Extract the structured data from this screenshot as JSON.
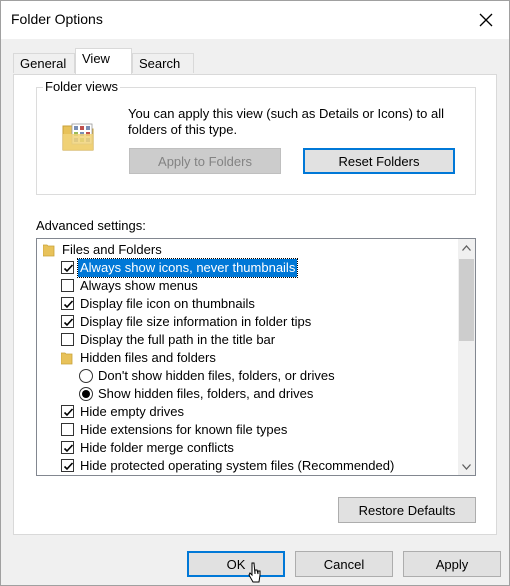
{
  "window": {
    "title": "Folder Options"
  },
  "tabs": [
    {
      "label": "General",
      "active": false
    },
    {
      "label": "View",
      "active": true
    },
    {
      "label": "Search",
      "active": false
    }
  ],
  "folder_views": {
    "legend": "Folder views",
    "description": "You can apply this view (such as Details or Icons) to all folders of this type.",
    "apply_button": "Apply to Folders",
    "reset_button": "Reset Folders"
  },
  "advanced": {
    "label": "Advanced settings:",
    "items": [
      {
        "type": "folder",
        "label": "Files and Folders",
        "level": 0
      },
      {
        "type": "checkbox",
        "label": "Always show icons, never thumbnails",
        "checked": true,
        "selected": true,
        "level": 1
      },
      {
        "type": "checkbox",
        "label": "Always show menus",
        "checked": false,
        "level": 1
      },
      {
        "type": "checkbox",
        "label": "Display file icon on thumbnails",
        "checked": true,
        "level": 1
      },
      {
        "type": "checkbox",
        "label": "Display file size information in folder tips",
        "checked": true,
        "level": 1
      },
      {
        "type": "checkbox",
        "label": "Display the full path in the title bar",
        "checked": false,
        "level": 1
      },
      {
        "type": "folder",
        "label": "Hidden files and folders",
        "level": 1
      },
      {
        "type": "radio",
        "label": "Don't show hidden files, folders, or drives",
        "checked": false,
        "level": 2
      },
      {
        "type": "radio",
        "label": "Show hidden files, folders, and drives",
        "checked": true,
        "level": 2
      },
      {
        "type": "checkbox",
        "label": "Hide empty drives",
        "checked": true,
        "level": 1
      },
      {
        "type": "checkbox",
        "label": "Hide extensions for known file types",
        "checked": false,
        "level": 1
      },
      {
        "type": "checkbox",
        "label": "Hide folder merge conflicts",
        "checked": true,
        "level": 1
      },
      {
        "type": "checkbox",
        "label": "Hide protected operating system files (Recommended)",
        "checked": true,
        "level": 1
      }
    ],
    "restore_button": "Restore Defaults"
  },
  "footer": {
    "ok": "OK",
    "cancel": "Cancel",
    "apply": "Apply"
  },
  "colors": {
    "accent": "#0078d7",
    "selection": "#0078d7",
    "folder": "#e8c25a"
  }
}
